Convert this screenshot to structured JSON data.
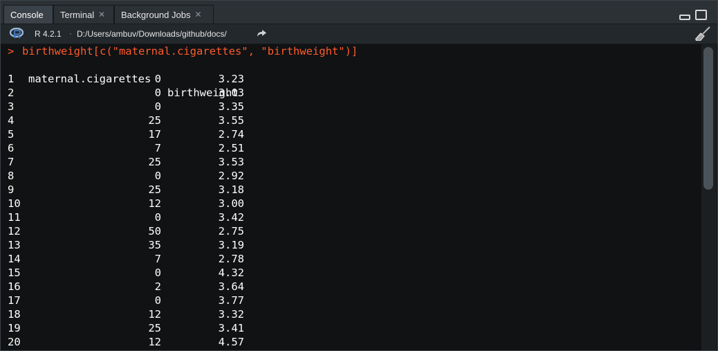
{
  "tabs": [
    {
      "label": "Console",
      "closable": false,
      "active": true
    },
    {
      "label": "Terminal",
      "closable": true,
      "active": false
    },
    {
      "label": "Background Jobs",
      "closable": true,
      "active": false
    }
  ],
  "toolbar": {
    "r_version": "R 4.2.1",
    "separator": "·",
    "working_dir": "D:/Users/ambuv/Downloads/github/docs/",
    "icons": [
      "r-logo-icon",
      "goto-directory-icon",
      "clear-console-broom-icon"
    ]
  },
  "window_controls": [
    "minimize-icon",
    "maximize-icon"
  ],
  "console": {
    "prompt": ">",
    "command": "birthweight[c(\"maternal.cigarettes\", \"birthweight\")]",
    "columns": [
      "maternal.cigarettes",
      "birthweight"
    ],
    "rows": [
      {
        "n": "1",
        "cig": "0",
        "bw": "3.23"
      },
      {
        "n": "2",
        "cig": "0",
        "bw": "3.03"
      },
      {
        "n": "3",
        "cig": "0",
        "bw": "3.35"
      },
      {
        "n": "4",
        "cig": "25",
        "bw": "3.55"
      },
      {
        "n": "5",
        "cig": "17",
        "bw": "2.74"
      },
      {
        "n": "6",
        "cig": "7",
        "bw": "2.51"
      },
      {
        "n": "7",
        "cig": "25",
        "bw": "3.53"
      },
      {
        "n": "8",
        "cig": "0",
        "bw": "2.92"
      },
      {
        "n": "9",
        "cig": "25",
        "bw": "3.18"
      },
      {
        "n": "10",
        "cig": "12",
        "bw": "3.00"
      },
      {
        "n": "11",
        "cig": "0",
        "bw": "3.42"
      },
      {
        "n": "12",
        "cig": "50",
        "bw": "2.75"
      },
      {
        "n": "13",
        "cig": "35",
        "bw": "3.19"
      },
      {
        "n": "14",
        "cig": "7",
        "bw": "2.78"
      },
      {
        "n": "15",
        "cig": "0",
        "bw": "4.32"
      },
      {
        "n": "16",
        "cig": "2",
        "bw": "3.64"
      },
      {
        "n": "17",
        "cig": "0",
        "bw": "3.77"
      },
      {
        "n": "18",
        "cig": "12",
        "bw": "3.32"
      },
      {
        "n": "19",
        "cig": "25",
        "bw": "3.41"
      },
      {
        "n": "20",
        "cig": "12",
        "bw": "4.57"
      }
    ]
  },
  "colors": {
    "command_text": "#ff5b2b",
    "output_text": "#ffffff",
    "background": "#101214",
    "tab_bar": "#2c3136"
  }
}
